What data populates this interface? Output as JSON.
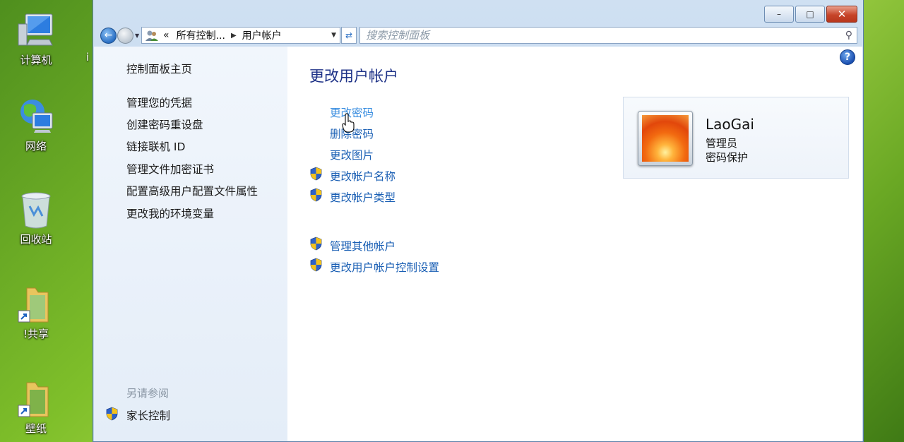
{
  "desktop": {
    "icons": [
      {
        "label": "计算机"
      },
      {
        "label": "网络"
      },
      {
        "label": "回收站"
      },
      {
        "label": "!共享"
      },
      {
        "label": "壁纸"
      }
    ],
    "partial_label": "i"
  },
  "window": {
    "buttons": {
      "minimize": "–",
      "maximize": "□",
      "close": "✕"
    },
    "address": {
      "overflow": "«",
      "crumbs": [
        "所有控制...",
        "用户帐户"
      ]
    },
    "search": {
      "placeholder": "搜索控制面板"
    }
  },
  "left_pane": {
    "home": "控制面板主页",
    "links": [
      "管理您的凭据",
      "创建密码重设盘",
      "链接联机 ID",
      "管理文件加密证书",
      "配置高级用户配置文件属性",
      "更改我的环境变量"
    ],
    "see_also_title": "另请参阅",
    "parental_control": "家长控制"
  },
  "main": {
    "title": "更改用户帐户",
    "tasks": [
      {
        "label": "更改密码",
        "shield": false
      },
      {
        "label": "删除密码",
        "shield": false
      },
      {
        "label": "更改图片",
        "shield": false
      },
      {
        "label": "更改帐户名称",
        "shield": true
      },
      {
        "label": "更改帐户类型",
        "shield": true
      }
    ],
    "other_tasks": [
      {
        "label": "管理其他帐户",
        "shield": true
      },
      {
        "label": "更改用户帐户控制设置",
        "shield": true
      }
    ]
  },
  "user": {
    "name": "LaoGai",
    "role": "管理员",
    "status": "密码保护"
  },
  "colors": {
    "link": "#1a5fb4",
    "title": "#1e3287",
    "shield_blue": "#2e62c9",
    "shield_yellow": "#f4c21b"
  }
}
